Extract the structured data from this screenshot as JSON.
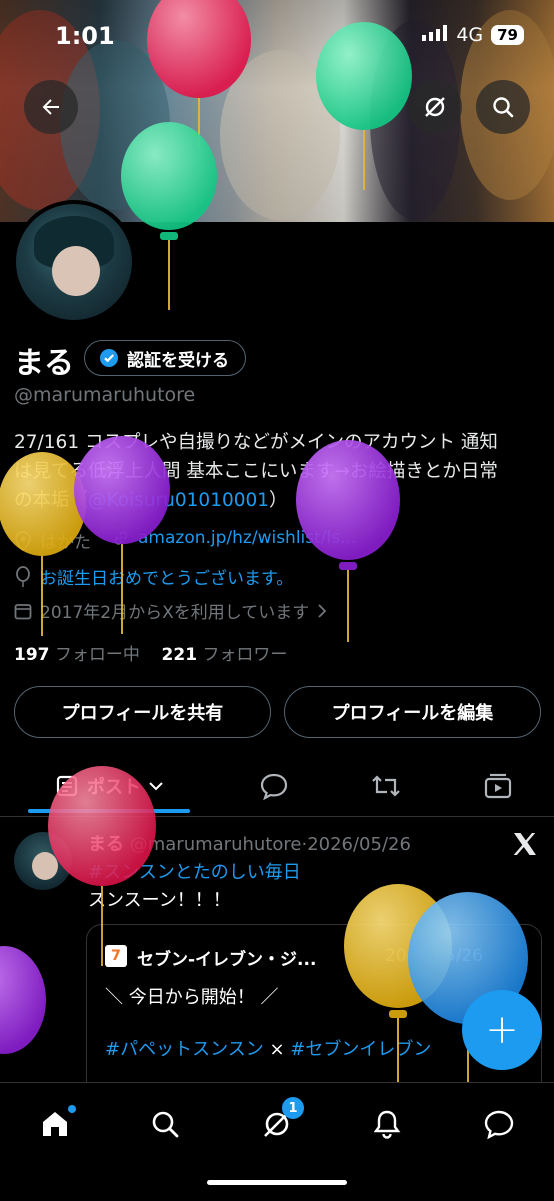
{
  "status_bar": {
    "time": "1:01",
    "network": "4G",
    "battery": "79"
  },
  "profile": {
    "name": "まる",
    "verify_label": "認証を受ける",
    "handle": "@marumaruhutore",
    "bio_line1": "27/161 コスプレや自撮りなどがメインのアカウント 通知",
    "bio_line2": "は見てる低浮上人間 基本ここにいます→お絵描きとか日常",
    "bio_line3_prefix": "の本垢（",
    "bio_link": "@Koisuru01010001",
    "bio_line3_suffix": "）",
    "location": "はかた",
    "website": "amazon.jp/hz/wishlist/ls...",
    "birthday": "お誕生日おめでとうございます。",
    "joined": "2017年2月からXを利用しています",
    "following_count": "197",
    "following_label": "フォロー中",
    "followers_count": "221",
    "followers_label": "フォロワー"
  },
  "buttons": {
    "share": "プロフィールを共有",
    "edit": "プロフィールを編集"
  },
  "tabs": {
    "posts": "ポスト"
  },
  "post": {
    "author": "まる",
    "handle": "@marumaruhutore",
    "separator": "·",
    "date": "2026/05/26",
    "hashtag": "#スンスンとたのしい毎日",
    "text": "スンスーン！！！",
    "quote": {
      "logo": "7",
      "author": "セブン-イレブン・ジ...",
      "date": "2026/05/26",
      "line1": "＼ 今日から開始！ ／",
      "tag1": "#パペットスンスン",
      "times": "×",
      "tag2": "#セブンイレブン"
    }
  },
  "fab_label": "+",
  "notifications_badge": "1",
  "colors": {
    "accent": "#1d9bf0",
    "background": "#000000",
    "muted": "#71767b",
    "border": "#2f3336"
  },
  "icons": [
    "back-arrow-icon",
    "grok-icon",
    "search-icon",
    "verified-badge-icon",
    "location-icon",
    "link-icon",
    "balloon-icon",
    "calendar-icon",
    "chevron-right-icon",
    "posts-tab-icon",
    "chevron-down-icon",
    "reply-icon",
    "repost-icon",
    "media-icon",
    "x-logo-icon",
    "home-icon",
    "notifications-icon",
    "messages-icon"
  ]
}
